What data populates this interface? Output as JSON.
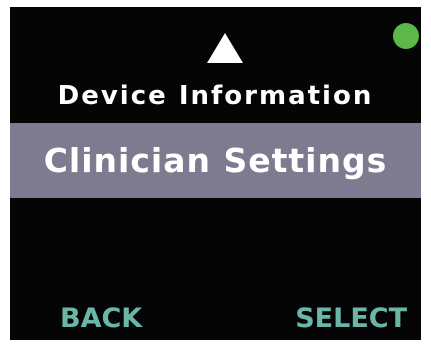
{
  "colors": {
    "screen_background": "#050505",
    "status_indicator": "#5db84a",
    "selection_highlight": "#7e7b91",
    "softkey_text": "#6ab7a7",
    "text": "#ffffff"
  },
  "status_indicator": {
    "icon": "green-status-dot"
  },
  "navigation": {
    "scroll_up_icon": "up-triangle"
  },
  "menu": {
    "previous_item": "Device Information",
    "selected_item": "Clinician Settings"
  },
  "softkeys": {
    "back_label": "BACK",
    "select_label": "SELECT"
  }
}
